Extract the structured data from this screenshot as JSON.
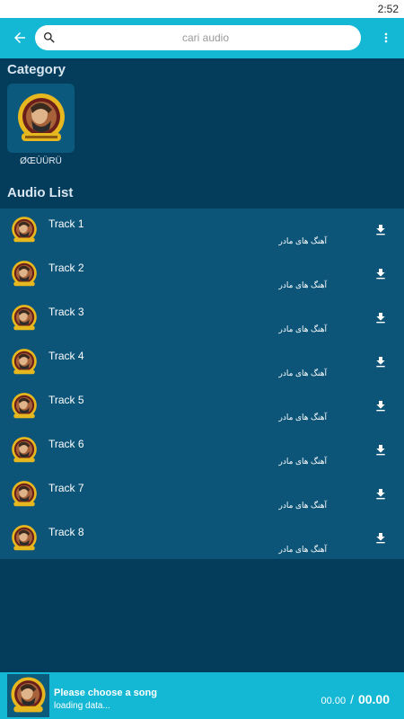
{
  "status_bar": {
    "time": "2:52"
  },
  "search": {
    "placeholder": "cari audio"
  },
  "sections": {
    "category": "Category",
    "audio_list": "Audio List"
  },
  "category": {
    "label": "ØŒÙÜRÜ"
  },
  "tracks": [
    {
      "title": "Track 1",
      "subtitle": "آهنگ های مادر"
    },
    {
      "title": "Track 2",
      "subtitle": "آهنگ های مادر"
    },
    {
      "title": "Track 3",
      "subtitle": "آهنگ های مادر"
    },
    {
      "title": "Track 4",
      "subtitle": "آهنگ های مادر"
    },
    {
      "title": "Track 5",
      "subtitle": "آهنگ های مادر"
    },
    {
      "title": "Track 6",
      "subtitle": "آهنگ های مادر"
    },
    {
      "title": "Track 7",
      "subtitle": "آهنگ های مادر"
    },
    {
      "title": "Track 8",
      "subtitle": "آهنگ های مادر"
    }
  ],
  "player": {
    "title": "Please choose a song",
    "status": "loading data...",
    "current_time": "00.00",
    "separator": "/",
    "total_time": "00.00"
  },
  "icons": {
    "back": "arrow-back-icon",
    "search": "search-icon",
    "menu": "more-vert-icon",
    "download": "download-icon",
    "thumbnail": "album-art-icon"
  },
  "colors": {
    "app_bar": "#14b8d4",
    "background": "#043d5c",
    "list_background": "#0c5579",
    "player_bar": "#14b8d4",
    "accent_gold": "#e6b71e"
  }
}
